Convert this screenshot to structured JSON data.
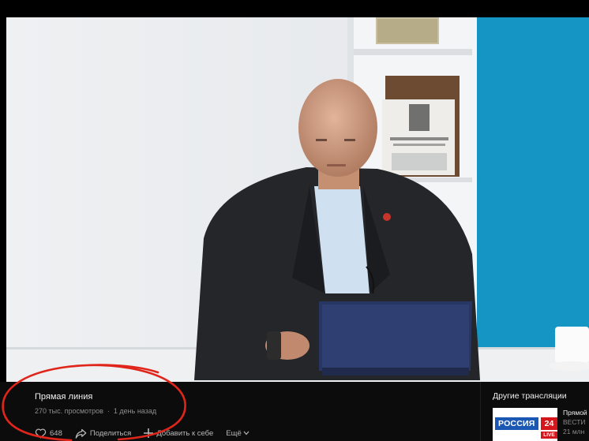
{
  "video": {
    "title": "Прямая линия",
    "views": "270 тыс. просмотров",
    "separator": "·",
    "age": "1 день назад"
  },
  "actions": {
    "likes": "648",
    "share": "Поделиться",
    "add": "Добавить к себе",
    "more": "Ещё"
  },
  "sidebar": {
    "heading": "Другие трансляции",
    "items": [
      {
        "title": "Прямой",
        "channel": "ВЕСТИ",
        "views": "21 млн",
        "thumb_logo": "РОССИЯ",
        "thumb_num": "24",
        "thumb_live": "LIVE"
      }
    ]
  },
  "colors": {
    "annotation": "#e0251b",
    "wall_blue": "#1595c4",
    "channel_blue": "#1a58b3",
    "channel_red": "#d5161c"
  },
  "icons": [
    "heart-icon",
    "share-icon",
    "plus-icon",
    "chevron-down-icon"
  ]
}
